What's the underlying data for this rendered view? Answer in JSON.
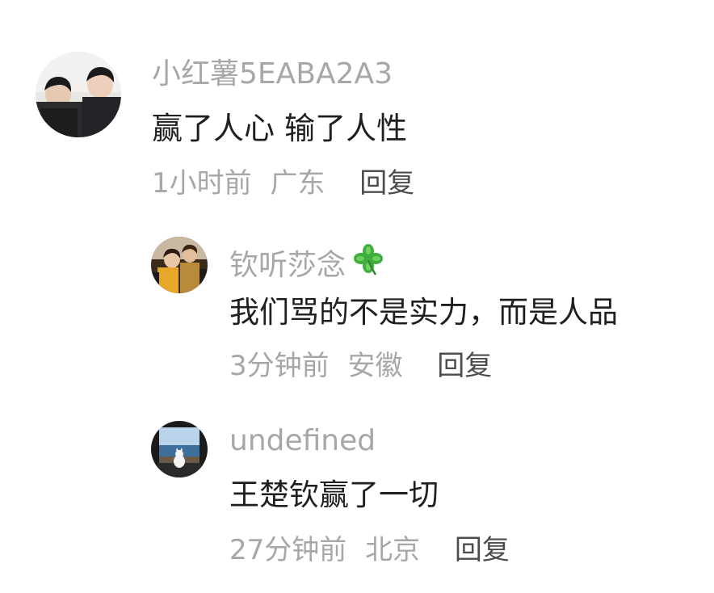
{
  "comments": [
    {
      "author": "小红薯5EABA2A3",
      "text": "赢了人心 输了人性",
      "time": "1小时前",
      "region": "广东",
      "reply_label": "回复",
      "avatar_icon": "user-avatar-two-people"
    }
  ],
  "replies": [
    {
      "author": "钦听莎念",
      "author_badge_icon": "four-leaf-clover-icon",
      "text": "我们骂的不是实力，而是人品",
      "time": "3分钟前",
      "region": "安徽",
      "reply_label": "回复",
      "avatar_icon": "user-avatar-photo"
    },
    {
      "author": "undefined",
      "text": "王楚钦赢了一切",
      "time": "27分钟前",
      "region": "北京",
      "reply_label": "回复",
      "avatar_icon": "user-avatar-cat-window"
    }
  ],
  "colors": {
    "meta_gray": "#a7a7a7",
    "text_dark": "#1f1f1f",
    "reply_dark": "#4c4c4c",
    "clover_green": "#3fae3f"
  }
}
